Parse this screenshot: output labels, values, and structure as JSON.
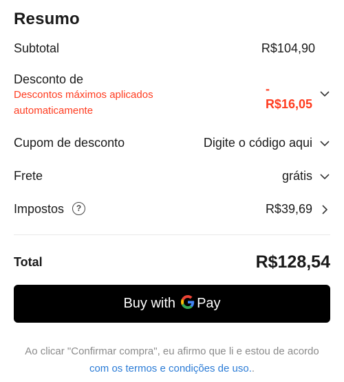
{
  "summary": {
    "title": "Resumo",
    "subtotal": {
      "label": "Subtotal",
      "value": "R$104,90"
    },
    "discount": {
      "label": "Desconto de",
      "sublabel": "Descontos máximos aplicados automaticamente",
      "sign": "-",
      "value": "R$16,05"
    },
    "coupon": {
      "label": "Cupom de desconto",
      "placeholder": "Digite o código aqui"
    },
    "shipping": {
      "label": "Frete",
      "value": "grátis"
    },
    "taxes": {
      "label": "Impostos",
      "help_glyph": "?",
      "value": "R$39,69"
    },
    "total": {
      "label": "Total",
      "value": "R$128,54"
    }
  },
  "pay_button": {
    "prefix": "Buy with",
    "brand_letter": "G",
    "brand_text": "Pay"
  },
  "footer": {
    "text": "Ao clicar \"Confirmar compra\", eu afirmo que li e estou de acordo",
    "link": "com os termos e condições de uso.",
    "trailing": "."
  },
  "colors": {
    "discount": "#ff3b1f",
    "link": "#2a7bd6",
    "button": "#000000"
  },
  "icons": [
    "chevron-down-icon",
    "chevron-right-icon",
    "help-circle-icon",
    "google-g-icon"
  ]
}
